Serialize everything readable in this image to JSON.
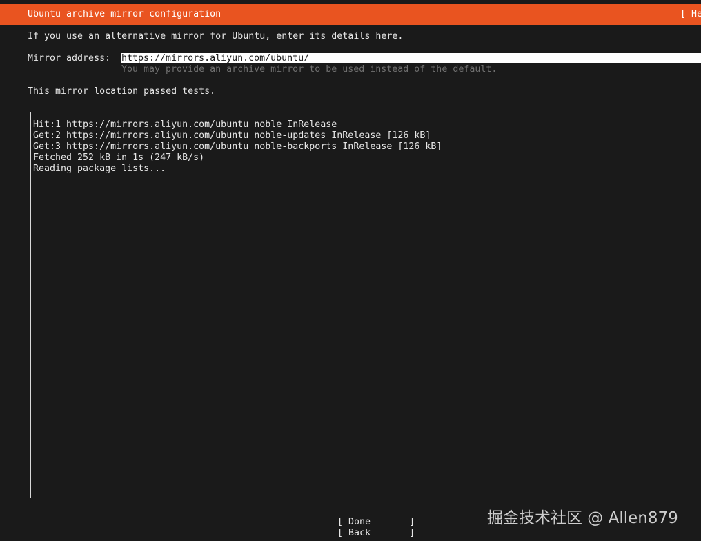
{
  "header": {
    "title": "Ubuntu archive mirror configuration",
    "help_label": "[ He"
  },
  "intro_text": "If you use an alternative mirror for Ubuntu, enter its details here.",
  "mirror": {
    "label": "Mirror address:",
    "value": "https://mirrors.aliyun.com/ubuntu/",
    "help": "You may provide an archive mirror to be used instead of the default."
  },
  "status_text": "This mirror location passed tests.",
  "log": {
    "lines": [
      "Hit:1 https://mirrors.aliyun.com/ubuntu noble InRelease",
      "Get:2 https://mirrors.aliyun.com/ubuntu noble-updates InRelease [126 kB]",
      "Get:3 https://mirrors.aliyun.com/ubuntu noble-backports InRelease [126 kB]",
      "Fetched 252 kB in 1s (247 kB/s)",
      "Reading package lists..."
    ]
  },
  "buttons": {
    "done": "[ Done       ]",
    "back": "[ Back       ]"
  },
  "watermark": "掘金技术社区 @ Allen879",
  "colors": {
    "accent": "#e95420",
    "background": "#1a1a1a"
  }
}
